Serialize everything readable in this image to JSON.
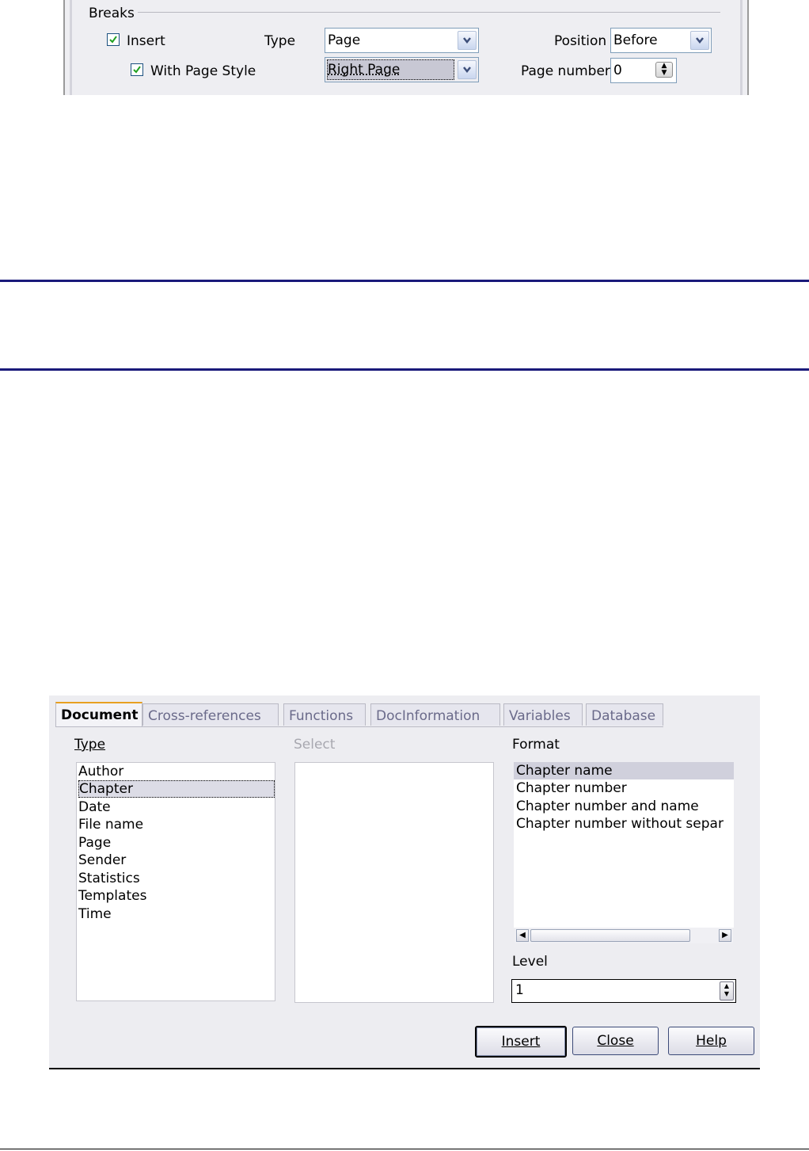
{
  "breaks": {
    "group_title": "Breaks",
    "insert": {
      "label": "Insert",
      "checked": true
    },
    "with_page_style": {
      "label": "With Page Style",
      "checked": true
    },
    "type": {
      "label": "Type",
      "value": "Page"
    },
    "page_style": {
      "value": "Right Page"
    },
    "position": {
      "label": "Position",
      "value": "Before"
    },
    "page_number": {
      "label": "Page number",
      "value": "0"
    }
  },
  "fields_dialog": {
    "tabs": [
      "Document",
      "Cross-references",
      "Functions",
      "DocInformation",
      "Variables",
      "Database"
    ],
    "active_tab": "Document",
    "type_label": "Type",
    "type_items": [
      "Author",
      "Chapter",
      "Date",
      "File name",
      "Page",
      "Sender",
      "Statistics",
      "Templates",
      "Time"
    ],
    "type_selected": "Chapter",
    "select_label": "Select",
    "format_label": "Format",
    "format_items": [
      "Chapter name",
      "Chapter number",
      "Chapter number and name",
      "Chapter number without separ"
    ],
    "format_selected": "Chapter name",
    "level_label": "Level",
    "level_value": "1",
    "buttons": {
      "insert": "Insert",
      "close": "Close",
      "help": "Help"
    }
  },
  "colors": {
    "separator": "#1a1a7a",
    "dialog_bg": "#ededf1",
    "active_tab_accent": "#e8a020"
  }
}
